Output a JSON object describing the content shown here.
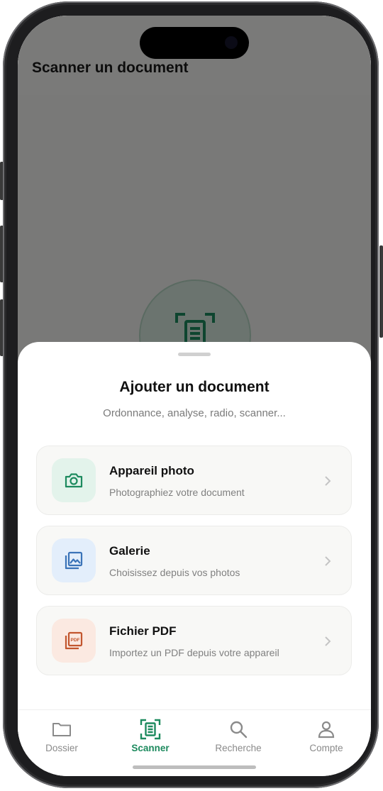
{
  "app": {
    "page_title": "Scanner un document"
  },
  "sheet": {
    "title": "Ajouter un document",
    "subtitle": "Ordonnance, analyse, radio, scanner...",
    "options": [
      {
        "title": "Appareil photo",
        "subtitle": "Photographiez votre document",
        "icon": "camera-icon",
        "color": "#1d8a5e",
        "bg": "#e3f3eb"
      },
      {
        "title": "Galerie",
        "subtitle": "Choisissez depuis vos photos",
        "icon": "gallery-icon",
        "color": "#3a73b8",
        "bg": "#e3eefb"
      },
      {
        "title": "Fichier PDF",
        "subtitle": "Importez un PDF depuis votre appareil",
        "icon": "pdf-file-icon",
        "color": "#c2562e",
        "bg": "#fbe9e1"
      }
    ]
  },
  "tabbar": {
    "tabs": [
      {
        "label": "Dossier",
        "icon": "folder-icon",
        "active": false
      },
      {
        "label": "Scanner",
        "icon": "scanner-icon",
        "active": true
      },
      {
        "label": "Recherche",
        "icon": "search-icon",
        "active": false
      },
      {
        "label": "Compte",
        "icon": "account-icon",
        "active": false
      }
    ],
    "active_color": "#1d8a5e",
    "inactive_color": "#8a8a8a"
  }
}
